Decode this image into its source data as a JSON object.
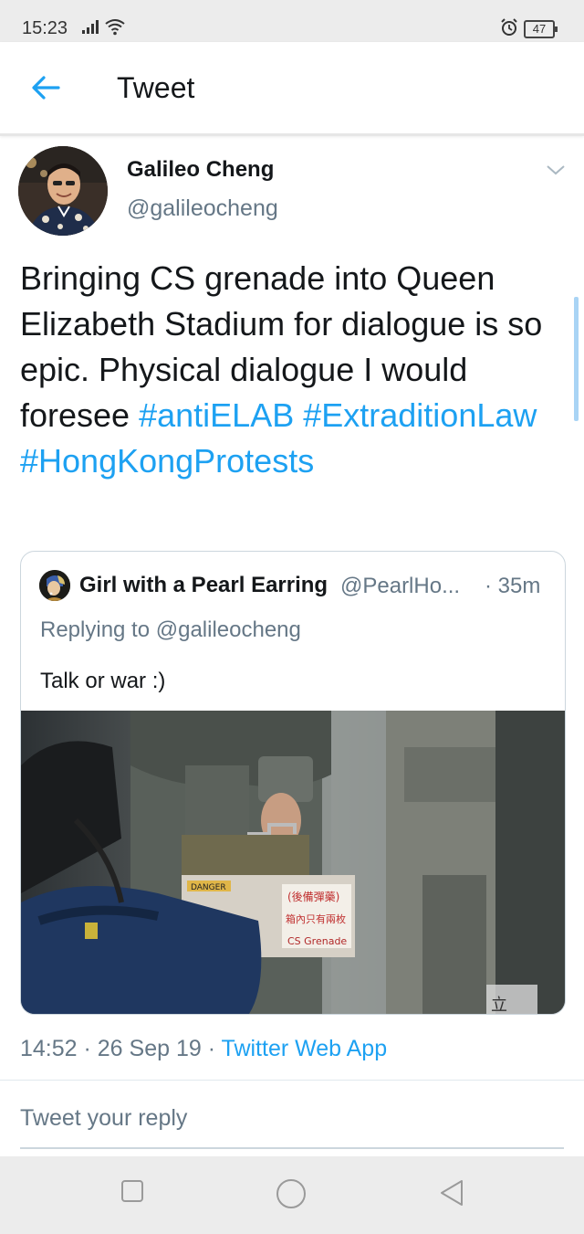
{
  "status_bar": {
    "time": "15:23",
    "battery": "47"
  },
  "header": {
    "title": "Tweet"
  },
  "tweet": {
    "author_name": "Galileo Cheng",
    "author_handle": "@galileocheng",
    "text_plain": "Bringing CS grenade into Queen Elizabeth Stadium for dialogue is so epic. Physical dialogue I would foresee",
    "hashtags": [
      "#antiELAB",
      "#ExtraditionLaw",
      "#HongKongProtests"
    ],
    "timestamp": "14:52 · 26 Sep 19 · ",
    "source": "Twitter Web App"
  },
  "quoted_tweet": {
    "author_name": "Girl with a Pearl Earring",
    "author_handle": "@PearlHo...",
    "time": "· 35m",
    "replying_to": "Replying to @galileocheng",
    "text": "Talk or war :)",
    "image_text": {
      "danger": "DANGER",
      "chinese_1": "(後備彈藥)",
      "chinese_2": "箱內只有兩枚",
      "label": "CS Grenade",
      "corner": "立"
    }
  },
  "reply": {
    "placeholder": "Tweet your reply"
  },
  "colors": {
    "accent": "#1da1f2",
    "secondary_text": "#657786",
    "primary_text": "#14171a"
  },
  "icons": [
    "back-arrow-icon",
    "chevron-down-icon",
    "signal-icon",
    "wifi-icon",
    "alarm-icon",
    "battery-icon",
    "recents-icon",
    "home-icon",
    "back-icon"
  ]
}
